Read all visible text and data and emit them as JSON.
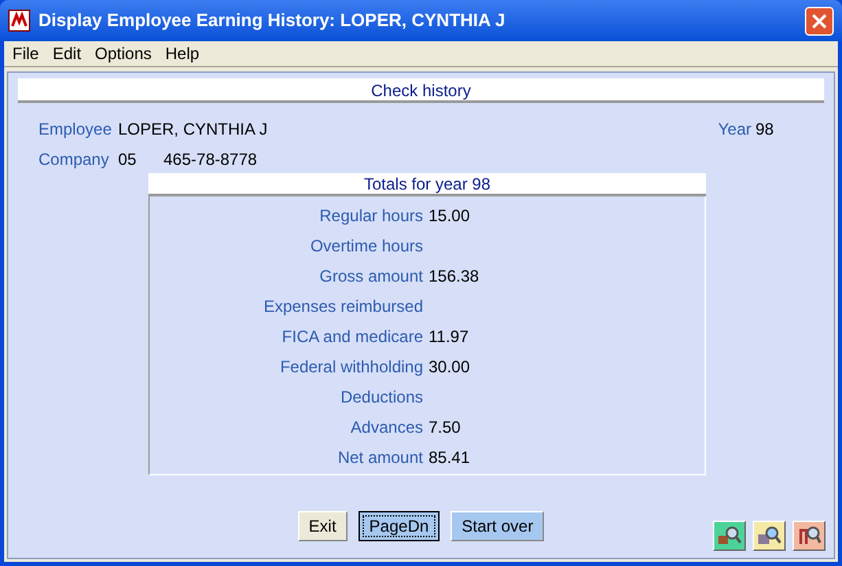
{
  "window": {
    "title": "Display Employee Earning History:  LOPER, CYNTHIA J"
  },
  "menu": [
    "File",
    "Edit",
    "Options",
    "Help"
  ],
  "section_title": "Check history",
  "employee": {
    "label": "Employee",
    "value": "LOPER, CYNTHIA J"
  },
  "year": {
    "label": "Year",
    "value": "98"
  },
  "company": {
    "label": "Company",
    "code": "05",
    "ssn": "465-78-8778"
  },
  "totals": {
    "title": "Totals for year 98",
    "rows": [
      {
        "label": "Regular hours",
        "value": "15.00"
      },
      {
        "label": "Overtime hours"
      },
      {
        "label": "Gross amount",
        "value": "156.38"
      },
      {
        "label": "Expenses reimbursed"
      },
      {
        "label": "FICA and medicare",
        "value": "11.97"
      },
      {
        "label": "Federal withholding",
        "value": "30.00"
      },
      {
        "label": "Deductions"
      },
      {
        "label": "Advances",
        "value": "7.50"
      },
      {
        "label": "Net amount",
        "value": "85.41"
      }
    ]
  },
  "buttons": [
    {
      "label": "Exit",
      "kind": "plain",
      "focused": false
    },
    {
      "label": "PageDn",
      "kind": "highlight",
      "focused": true
    },
    {
      "label": "Start over",
      "kind": "highlight",
      "focused": false
    }
  ]
}
